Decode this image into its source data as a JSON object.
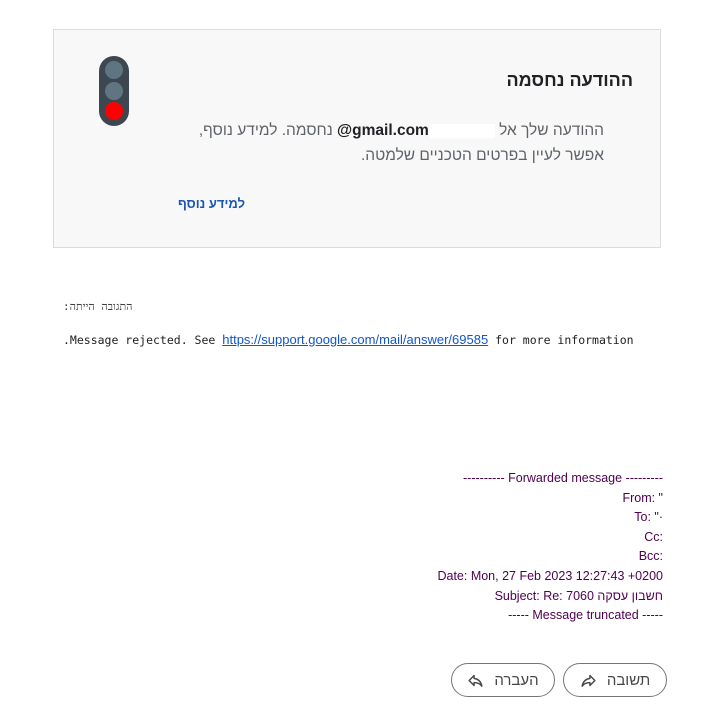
{
  "card": {
    "title": "ההודעה נחסמה",
    "body_prefix": "ההודעה שלך אל ",
    "email": "@gmail.com",
    "body_suffix": " נחסמה. למידע נוסף, אפשר לעיין בפרטים הטכניים שלמטה.",
    "learn_more": "למידע נוסף",
    "icon": "traffic-light-icon"
  },
  "response": {
    "label": "התגובה הייתה:",
    "prefix": ".Message rejected. See ",
    "link": "https://support.google.com/mail/answer/69585",
    "suffix": " for more information"
  },
  "forwarded": {
    "header": "---------- Forwarded message ---------",
    "from": "From: \"",
    "to": "To: \"·",
    "cc": "Cc:",
    "bcc": "Bcc:",
    "date": "Date: Mon, 27 Feb 2023 12:27:43 +0200",
    "subject": "Subject: Re: חשבון עסקה 7060",
    "truncated": "----- Message truncated -----"
  },
  "actions": {
    "reply": "תשובה",
    "forward": "העברה",
    "reply_icon": "reply-icon",
    "forward_icon": "forward-icon"
  },
  "colors": {
    "alert_red": "#ff0000",
    "link_blue": "#1a57b0",
    "quote_purple": "#500050"
  }
}
